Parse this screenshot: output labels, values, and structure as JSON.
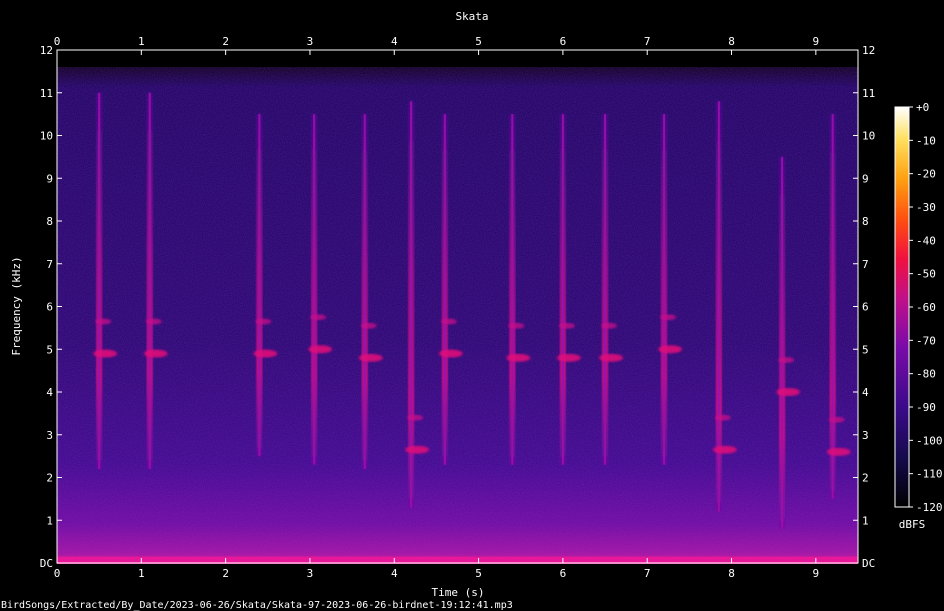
{
  "chart_data": {
    "type": "heatmap",
    "title": "Skata",
    "xlabel": "Time (s)",
    "ylabel": "Frequency (kHz)",
    "xlim": [
      0,
      9.5
    ],
    "ylim": [
      0,
      12
    ],
    "x_ticks": [
      "0",
      "1",
      "2",
      "3",
      "4",
      "5",
      "6",
      "7",
      "8",
      "9"
    ],
    "y_ticks": [
      "DC",
      "1",
      "2",
      "3",
      "4",
      "5",
      "6",
      "7",
      "8",
      "9",
      "10",
      "11",
      "12"
    ],
    "colorbar": {
      "label": "dBFS",
      "range": [
        -120,
        0
      ],
      "ticks": [
        "+0",
        "-10",
        "-20",
        "-30",
        "-40",
        "-50",
        "-60",
        "-70",
        "-80",
        "-90",
        "-100",
        "-110",
        "-120"
      ],
      "colors": [
        "#000000",
        "#150a4a",
        "#3a0a8a",
        "#7a0aa8",
        "#c0108a",
        "#f01040",
        "#ff5010",
        "#ffa010",
        "#ffe060",
        "#ffffff"
      ]
    },
    "calls": [
      {
        "t": 0.5,
        "f_top": 11,
        "f_bottom": 2.2,
        "peak_khz": 4.9
      },
      {
        "t": 1.1,
        "f_top": 11,
        "f_bottom": 2.2,
        "peak_khz": 4.9
      },
      {
        "t": 2.4,
        "f_top": 10.5,
        "f_bottom": 2.5,
        "peak_khz": 4.9
      },
      {
        "t": 3.05,
        "f_top": 10.5,
        "f_bottom": 2.3,
        "peak_khz": 5.0
      },
      {
        "t": 3.65,
        "f_top": 10.5,
        "f_bottom": 2.2,
        "peak_khz": 4.8
      },
      {
        "t": 4.2,
        "f_top": 10.8,
        "f_bottom": 1.3,
        "peak_khz": 2.65
      },
      {
        "t": 4.6,
        "f_top": 10.5,
        "f_bottom": 2.3,
        "peak_khz": 4.9
      },
      {
        "t": 5.4,
        "f_top": 10.5,
        "f_bottom": 2.3,
        "peak_khz": 4.8
      },
      {
        "t": 6.0,
        "f_top": 10.5,
        "f_bottom": 2.3,
        "peak_khz": 4.8
      },
      {
        "t": 6.5,
        "f_top": 10.5,
        "f_bottom": 2.3,
        "peak_khz": 4.8
      },
      {
        "t": 7.2,
        "f_top": 10.5,
        "f_bottom": 2.3,
        "peak_khz": 5.0
      },
      {
        "t": 7.85,
        "f_top": 10.8,
        "f_bottom": 1.2,
        "peak_khz": 2.65
      },
      {
        "t": 8.6,
        "f_top": 9.5,
        "f_bottom": 0.8,
        "peak_khz": 4.0
      },
      {
        "t": 9.2,
        "f_top": 10.5,
        "f_bottom": 1.5,
        "peak_khz": 2.6
      }
    ]
  },
  "footer": {
    "path": "BirdSongs/Extracted/By_Date/2023-06-26/Skata/Skata-97-2023-06-26-birdnet-19:12:41.mp3"
  }
}
